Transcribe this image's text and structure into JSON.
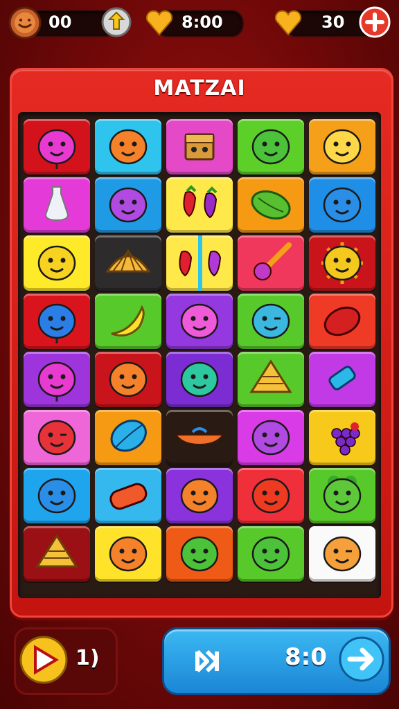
{
  "hud": {
    "coins_value": "00",
    "timer_value": "8:00",
    "lives_value": "30",
    "icons": [
      "coin-icon",
      "shield-icon",
      "heart-icon",
      "heart-icon",
      "plus-icon"
    ]
  },
  "board": {
    "title": "MATZAI",
    "rows": [
      [
        {
          "color": "#d4121c",
          "icon": "pink-balloon-face"
        },
        {
          "color": "#2ec4ee",
          "icon": "orange-face"
        },
        {
          "color": "#e449c8",
          "icon": "treasure-box"
        },
        {
          "color": "#5ccf28",
          "icon": "green-face"
        },
        {
          "color": "#f5a018",
          "icon": "blond-face"
        }
      ],
      [
        {
          "color": "#e43ad8",
          "icon": "glass-bottle"
        },
        {
          "color": "#1f9be6",
          "icon": "purple-face"
        },
        {
          "color": "#ffe84a",
          "icon": "strawberries"
        },
        {
          "color": "#f59a12",
          "icon": "green-fruit"
        },
        {
          "color": "#1f8ee6",
          "icon": "blue-face"
        }
      ],
      [
        {
          "color": "#ffea2a",
          "icon": "yellow-face"
        },
        {
          "color": "#2d2b2b",
          "icon": "seashell"
        },
        {
          "color": "#ffe84a",
          "icon": "strawberry-pair"
        },
        {
          "color": "#f0385c",
          "icon": "lollipop"
        },
        {
          "color": "#c8141a",
          "icon": "sun-face"
        }
      ],
      [
        {
          "color": "#d9141c",
          "icon": "blue-balloon-face"
        },
        {
          "color": "#58c92a",
          "icon": "banana"
        },
        {
          "color": "#9438e0",
          "icon": "pink-face"
        },
        {
          "color": "#58c92a",
          "icon": "winking-face"
        },
        {
          "color": "#ef3a26",
          "icon": "red-fruit"
        }
      ],
      [
        {
          "color": "#9d34dc",
          "icon": "pink-balloon-face"
        },
        {
          "color": "#c8141a",
          "icon": "orange-face"
        },
        {
          "color": "#7b2cd2",
          "icon": "teal-face"
        },
        {
          "color": "#58c92a",
          "icon": "cone"
        },
        {
          "color": "#c23ae6",
          "icon": "blue-candy"
        }
      ],
      [
        {
          "color": "#ef66d8",
          "icon": "red-wink-face"
        },
        {
          "color": "#f59a12",
          "icon": "blue-fruit"
        },
        {
          "color": "#2a1a14",
          "icon": "orange-boat"
        },
        {
          "color": "#d93ce6",
          "icon": "purple-face"
        },
        {
          "color": "#f7c91a",
          "icon": "grapes"
        }
      ],
      [
        {
          "color": "#1fa4ee",
          "icon": "blue-face"
        },
        {
          "color": "#34b8ee",
          "icon": "red-log"
        },
        {
          "color": "#8a33dc",
          "icon": "orange-face"
        },
        {
          "color": "#ef2f3a",
          "icon": "tomato-face"
        },
        {
          "color": "#58c92a",
          "icon": "bush-face"
        }
      ],
      [
        {
          "color": "#9a1014",
          "icon": "cone"
        },
        {
          "color": "#ffe22a",
          "icon": "orange-face"
        },
        {
          "color": "#ef5a16",
          "icon": "green-face"
        },
        {
          "color": "#58c92a",
          "icon": "green-face"
        },
        {
          "color": "#fafafa",
          "icon": "orange-wink-face"
        }
      ]
    ]
  },
  "controls": {
    "left_value": "1)",
    "right_value": "8:0",
    "icons": [
      "play-icon",
      "skip-icon",
      "arrow-right-icon"
    ]
  }
}
